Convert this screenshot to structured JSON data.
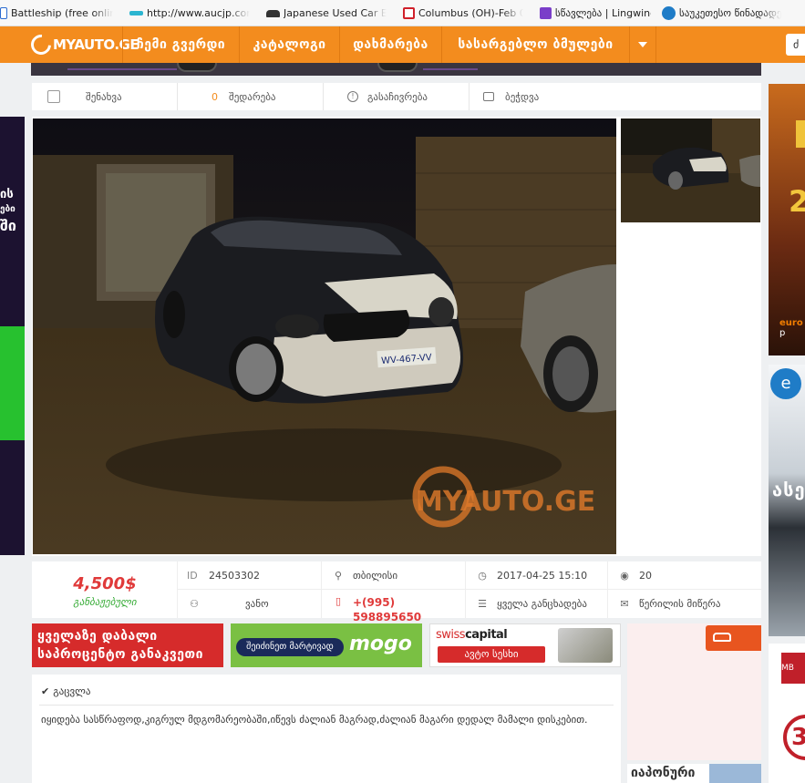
{
  "bookmarks": [
    {
      "label": "Battleship (free online g",
      "color": "#2a6ad0"
    },
    {
      "label": "http://www.aucjp.com/a",
      "color": "#2bb5d0"
    },
    {
      "label": "Japanese Used Car Expo",
      "color": "#333333"
    },
    {
      "label": "Columbus (OH)-Feb 01 2",
      "color": "#d0202a"
    },
    {
      "label": "სწავლება | Lingwing",
      "color": "#7a3ec9"
    },
    {
      "label": "საუკეთესო წინადადე",
      "color": "#1f7cc7"
    }
  ],
  "nav": {
    "logo": "MYAUTO.GE",
    "items": [
      "ჩემი გვერდი",
      "კატალოგი",
      "დახმარება",
      "სასარგებლო ბმულები"
    ],
    "search_text": "ძ"
  },
  "toolbar": {
    "save_label": "შენახვა",
    "compare_count": "0",
    "compare_label": "შედარება",
    "report_label": "გასაჩივრება",
    "print_label": "ბეჭდვა"
  },
  "photo": {
    "watermark": "MYAUTO.GE",
    "plate": "WV-467-VV"
  },
  "listing": {
    "price": "4,500$",
    "price_note": "განბაჟებული",
    "id_label": "ID",
    "id": "24503302",
    "location": "თბილისი",
    "date": "2017-04-25 15:10",
    "views": "20",
    "seller": "ვანო",
    "phone_line1": "+(995)",
    "phone_line2": "598895650",
    "all_listings": "ყველა განცხადება",
    "message": "წერილის მიწერა"
  },
  "sponsors": {
    "s1_line1": "ყველაზე დაბალი",
    "s1_line2": "საპროცენტო განაკვეთი",
    "s2_pill": "შეიძინეთ მარტივად",
    "s2_brand": "mogo",
    "s3_brand_a": "swiss",
    "s3_brand_b": "capital",
    "s3_cta": "ავტო სესხი"
  },
  "description": {
    "header": "გაცვლა",
    "text": "იყიდება სასწრაფოდ,კიგრულ მდგომარეობაში,იწევს ძალიან მაგრად,ძალიან მაგარი დედალ მამალი დისკებით."
  },
  "ads": {
    "left_line1": "ის",
    "left_line2": "ები",
    "left_line3": "ში",
    "right1_num": "2",
    "right1_brand_a": "euro",
    "right1_brand_b": " p",
    "right2_text": "ასე",
    "right3_num": "3",
    "right3_badge": "MB",
    "bottom_text": "იაპონური"
  }
}
